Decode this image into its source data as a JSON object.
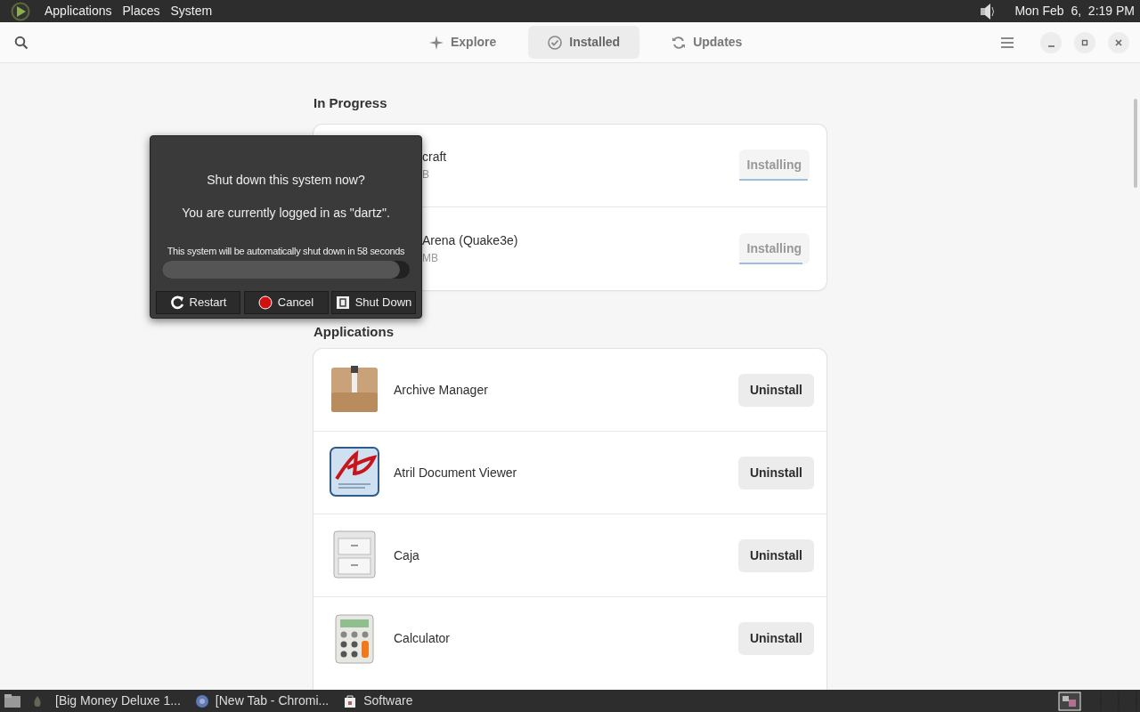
{
  "top_panel": {
    "menus": [
      "Applications",
      "Places",
      "System"
    ],
    "clock": "Mon Feb  6,  2:19 PM"
  },
  "header": {
    "tabs": [
      {
        "label": "Explore",
        "selected": false,
        "kind": "explore"
      },
      {
        "label": "Installed",
        "selected": true,
        "kind": "installed"
      },
      {
        "label": "Updates",
        "selected": false,
        "kind": "updates"
      }
    ]
  },
  "in_progress": {
    "title": "In Progress",
    "items": [
      {
        "name": "craft",
        "size": "B",
        "button": "Installing",
        "level": 0.97
      },
      {
        "name": "Arena (Quake3e)",
        "size": "MB",
        "button": "Installing",
        "level": 0.9
      }
    ]
  },
  "applications": {
    "title": "Applications",
    "items": [
      {
        "name": "Archive Manager",
        "button": "Uninstall",
        "kind": "archive"
      },
      {
        "name": "Atril Document Viewer",
        "button": "Uninstall",
        "kind": "document"
      },
      {
        "name": "Caja",
        "button": "Uninstall",
        "kind": "cabinet"
      },
      {
        "name": "Calculator",
        "button": "Uninstall",
        "kind": "calculator"
      }
    ]
  },
  "dialog": {
    "title": "Shut down this system now?",
    "message": "You are currently logged in as \"dartz\".",
    "countdown": "This system will be automatically shut down in 58 seconds",
    "level": 0.96,
    "buttons": [
      {
        "label": "Restart",
        "kind": "restart"
      },
      {
        "label": "Cancel",
        "kind": "cancel"
      },
      {
        "label": "Shut Down",
        "kind": "shutdown"
      }
    ]
  },
  "taskbar": {
    "items": [
      {
        "label": "[Big Money Deluxe 1...",
        "kind": "game"
      },
      {
        "label": "[New Tab - Chromi...",
        "kind": "browser"
      },
      {
        "label": "Software",
        "kind": "software"
      }
    ]
  }
}
